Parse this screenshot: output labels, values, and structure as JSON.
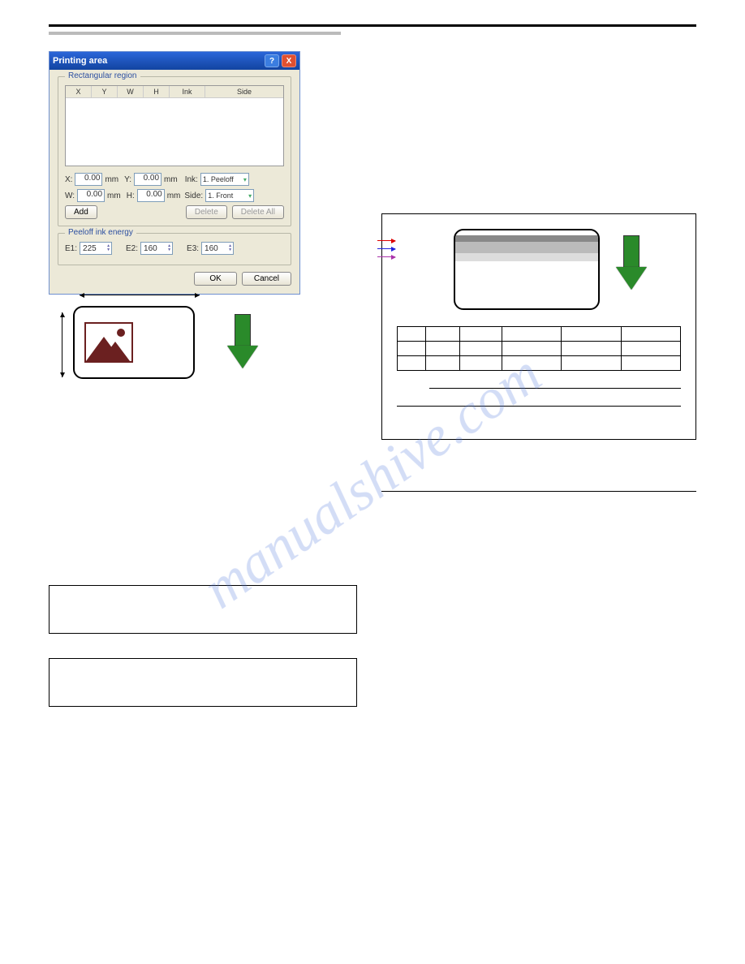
{
  "watermark": "manualshive.com",
  "dialog": {
    "title": "Printing area",
    "group1_label": "Rectangular region",
    "headers": {
      "x": "X",
      "y": "Y",
      "w": "W",
      "h": "H",
      "ink": "Ink",
      "side": "Side"
    },
    "fields": {
      "x_label": "X:",
      "x_val": "0.00",
      "x_unit": "mm",
      "y_label": "Y:",
      "y_val": "0.00",
      "y_unit": "mm",
      "w_label": "W:",
      "w_val": "0.00",
      "w_unit": "mm",
      "h_label": "H:",
      "h_val": "0.00",
      "h_unit": "mm",
      "ink_label": "Ink:",
      "ink_val": "1. Peeloff",
      "side_label": "Side:",
      "side_val": "1. Front"
    },
    "buttons": {
      "add": "Add",
      "delete": "Delete",
      "delete_all": "Delete All",
      "ok": "OK",
      "cancel": "Cancel"
    },
    "group2_label": "Peeloff ink energy",
    "energy": {
      "e1_label": "E1:",
      "e1_val": "225",
      "e2_label": "E2:",
      "e2_val": "160",
      "e3_label": "E3:",
      "e3_val": "160"
    }
  },
  "example": {
    "table_headers": [
      "",
      "",
      "",
      "",
      "",
      ""
    ],
    "table_rows": [
      [
        "",
        "",
        "",
        "",
        "",
        ""
      ],
      [
        "",
        "",
        "",
        "",
        "",
        ""
      ]
    ]
  }
}
